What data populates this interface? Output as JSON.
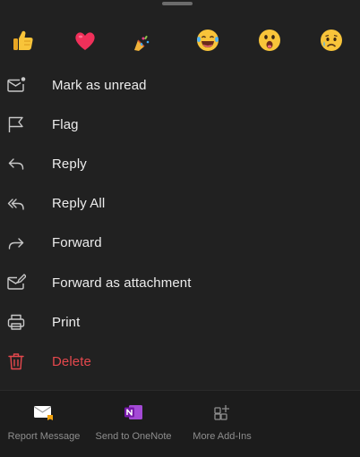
{
  "reactions": [
    {
      "name": "thumbs-up-icon"
    },
    {
      "name": "heart-icon"
    },
    {
      "name": "party-popper-icon"
    },
    {
      "name": "laughing-face-icon"
    },
    {
      "name": "surprised-face-icon"
    },
    {
      "name": "sad-face-icon"
    }
  ],
  "menu": {
    "mark_unread": "Mark as unread",
    "flag": "Flag",
    "reply": "Reply",
    "reply_all": "Reply All",
    "forward": "Forward",
    "forward_attachment": "Forward as attachment",
    "print": "Print",
    "delete": "Delete"
  },
  "addins": {
    "report": "Report Message",
    "onenote": "Send to OneNote",
    "more": "More Add-Ins"
  },
  "colors": {
    "background": "#212121",
    "text": "#ececec",
    "danger": "#e5484d",
    "icon": "#c8c8c8",
    "muted": "#8e8e8e",
    "onenote": "#7719aa"
  }
}
